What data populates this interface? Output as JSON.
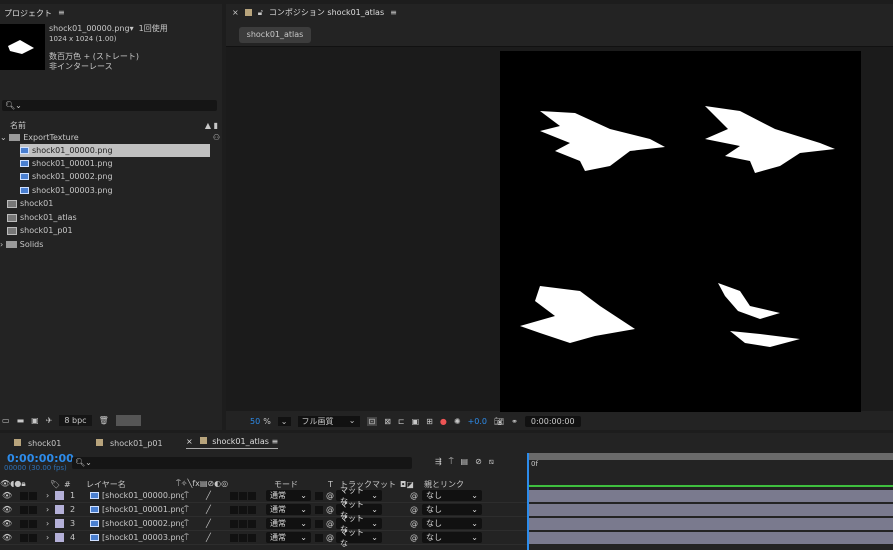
{
  "project": {
    "title": "プロジェクト",
    "menu_icon": "hamburger-icon",
    "thumb_name": "shock01_00000.png",
    "usage": "1回使用",
    "dims": "1024 x 1024 (1.00)",
    "color": "数百万色 + (ストレート)",
    "interlace": "非インターレース",
    "search_placeholder": "",
    "col_name": "名前",
    "items": [
      {
        "label": "ExportTexture",
        "type": "folder",
        "open": true
      },
      {
        "label": "shock01_00000.png",
        "type": "footage",
        "selected": true
      },
      {
        "label": "shock01_00001.png",
        "type": "footage"
      },
      {
        "label": "shock01_00002.png",
        "type": "footage"
      },
      {
        "label": "shock01_00003.png",
        "type": "footage"
      },
      {
        "label": "shock01",
        "type": "comp"
      },
      {
        "label": "shock01_atlas",
        "type": "comp"
      },
      {
        "label": "shock01_p01",
        "type": "comp"
      },
      {
        "label": "Solids",
        "type": "folder"
      }
    ],
    "bpc": "8 bpc"
  },
  "comp": {
    "panel_title": "コンポジション shock01_atlas",
    "tab": "shock01_atlas",
    "zoom": "50",
    "zoom_unit": "%",
    "quality": "フル画質",
    "exposure": "+0.0",
    "timecode": "0:00:00:00"
  },
  "timeline": {
    "tabs": [
      "shock01",
      "shock01_p01",
      "shock01_atlas"
    ],
    "active_tab": 2,
    "timecode": "0:00:00:00",
    "frame_info": "00000 (30.00 fps)",
    "ruler_label": "0f",
    "headers": {
      "num": "#",
      "layer_name": "レイヤー名",
      "mode": "モード",
      "t": "T",
      "track_matte": "トラックマット",
      "parent": "親とリンク"
    },
    "layers": [
      {
        "num": "1",
        "name": "[shock01_00000.png]",
        "mode": "通常",
        "matte": "マットな",
        "parent": "なし"
      },
      {
        "num": "2",
        "name": "[shock01_00001.png]",
        "mode": "通常",
        "matte": "マットな",
        "parent": "なし"
      },
      {
        "num": "3",
        "name": "[shock01_00002.png]",
        "mode": "通常",
        "matte": "マットな",
        "parent": "なし"
      },
      {
        "num": "4",
        "name": "[shock01_00003.png]",
        "mode": "通常",
        "matte": "マットな",
        "parent": "なし"
      }
    ]
  },
  "colors": {
    "accent": "#2d8ceb",
    "label": "#b4b0d8",
    "comp_tab": "#b8a47c",
    "layer_bar": "#7a7a8e"
  }
}
